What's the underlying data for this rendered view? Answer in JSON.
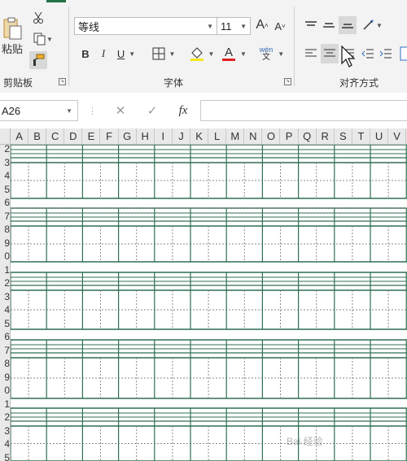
{
  "ribbon": {
    "clipboard": {
      "paste_label": "粘贴",
      "group_label": "剪贴板"
    },
    "font": {
      "font_name": "等线",
      "font_size": "11",
      "bold_label": "B",
      "italic_label": "I",
      "underline_label": "U",
      "font_color_label": "A",
      "phonetic_top": "wén",
      "phonetic_bottom": "文",
      "grow_label": "A",
      "shrink_label": "A",
      "group_label": "字体",
      "font_color": "#e02020"
    },
    "alignment": {
      "group_label": "对齐方式"
    }
  },
  "formula_bar": {
    "name_box": "A26",
    "fx_label": "fx",
    "formula": ""
  },
  "sheet": {
    "columns": [
      "A",
      "B",
      "C",
      "D",
      "E",
      "F",
      "G",
      "H",
      "I",
      "J",
      "K",
      "L",
      "M",
      "N",
      "O",
      "P",
      "Q",
      "R",
      "S",
      "T",
      "U",
      "V"
    ],
    "rows": [
      "2",
      "3",
      "4",
      "5",
      "6",
      "7",
      "8",
      "9",
      "0",
      "1",
      "2",
      "3",
      "4",
      "5",
      "6",
      "7",
      "8",
      "9",
      "0",
      "1",
      "2",
      "3",
      "4",
      "5"
    ],
    "line_color": "#2f6f52"
  },
  "watermark": "Bai 经验"
}
